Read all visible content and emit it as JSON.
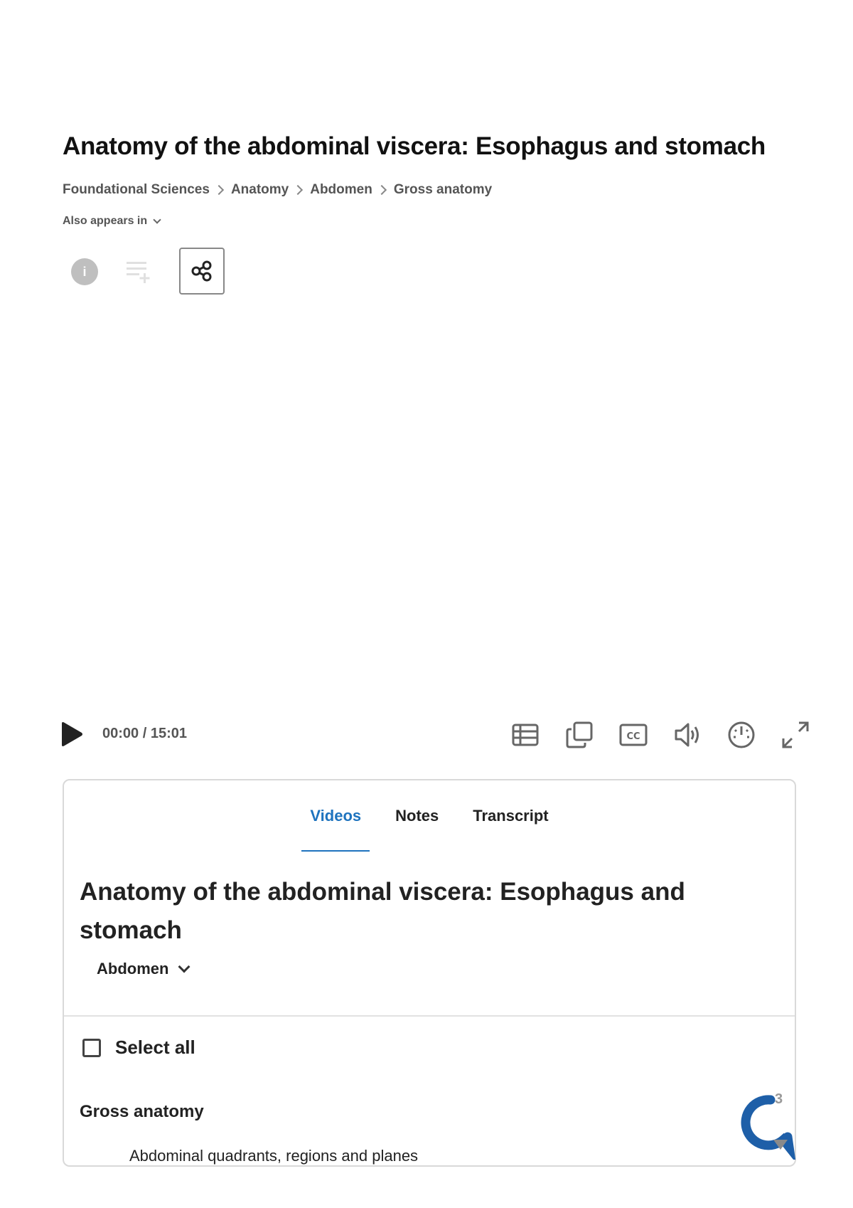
{
  "page": {
    "title": "Anatomy of the abdominal viscera: Esophagus and stomach"
  },
  "breadcrumb": [
    "Foundational Sciences",
    "Anatomy",
    "Abdomen",
    "Gross anatomy"
  ],
  "also_appears_in": "Also appears in",
  "toolbar_icons": [
    "info-icon",
    "add-to-playlist-icon",
    "share-icon"
  ],
  "player": {
    "timecode": "00:00 / 15:01",
    "controls": [
      "play-icon",
      "table-of-contents-icon",
      "picture-in-picture-icon",
      "closed-captions-icon",
      "volume-icon",
      "playback-speed-icon",
      "fullscreen-icon"
    ]
  },
  "panel": {
    "tabs": [
      {
        "label": "Videos",
        "active": true
      },
      {
        "label": "Notes",
        "active": false
      },
      {
        "label": "Transcript",
        "active": false
      }
    ],
    "title": "Anatomy of the abdominal viscera: Esophagus and stomach",
    "selector": "Abdomen",
    "select_all": "Select all",
    "group_heading": "Gross anatomy",
    "items": [
      "Abdominal quadrants, regions and planes"
    ]
  },
  "chat": {
    "badge": "3"
  },
  "colors": {
    "accent": "#1e73be",
    "chat": "#1e5fa8"
  }
}
